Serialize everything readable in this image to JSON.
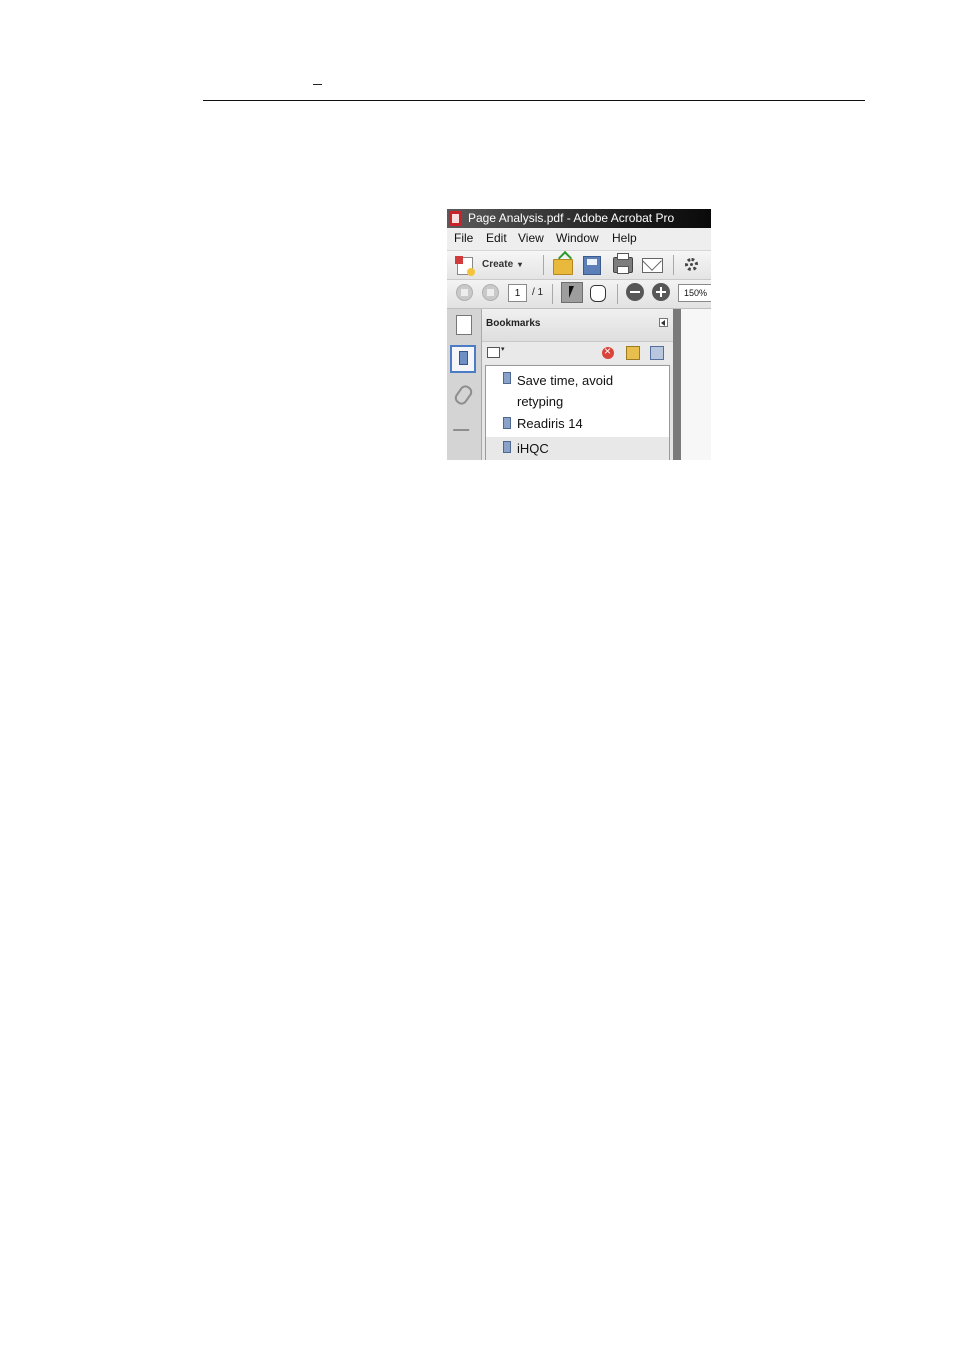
{
  "header": {
    "mark": "–"
  },
  "window": {
    "title": "Page Analysis.pdf - Adobe Acrobat Pro"
  },
  "menu": {
    "items": [
      "File",
      "Edit",
      "View",
      "Window",
      "Help"
    ]
  },
  "toolbar": {
    "create_label": "Create",
    "create_caret": "▾"
  },
  "navigation": {
    "current_page": "1",
    "total_pages": "/ 1",
    "zoom": "150%"
  },
  "bookmarks_panel": {
    "title": "Bookmarks",
    "options_caret": "▾",
    "items": [
      {
        "label_line1": "Save time, avoid",
        "label_line2": "retyping"
      },
      {
        "label": "Readiris 14"
      },
      {
        "label": "iHQC",
        "selected": true
      }
    ]
  },
  "icons": [
    "pdf-app-icon",
    "create-icon",
    "open-folder-icon",
    "save-icon",
    "print-icon",
    "email-icon",
    "gear-icon",
    "previous-page-icon",
    "next-page-icon",
    "select-tool-icon",
    "hand-icon",
    "zoom-out-icon",
    "zoom-in-icon",
    "pages-icon",
    "bookmark-icon",
    "attachment-icon",
    "signature-icon",
    "collapse-icon",
    "bookmark-options-icon",
    "delete-bookmark-icon",
    "new-bookmark-icon",
    "expand-bookmark-icon"
  ],
  "colors": {
    "titlebar": "#2a2a2a",
    "accent": "#4d7cc7",
    "pdf_red": "#c8232c"
  }
}
